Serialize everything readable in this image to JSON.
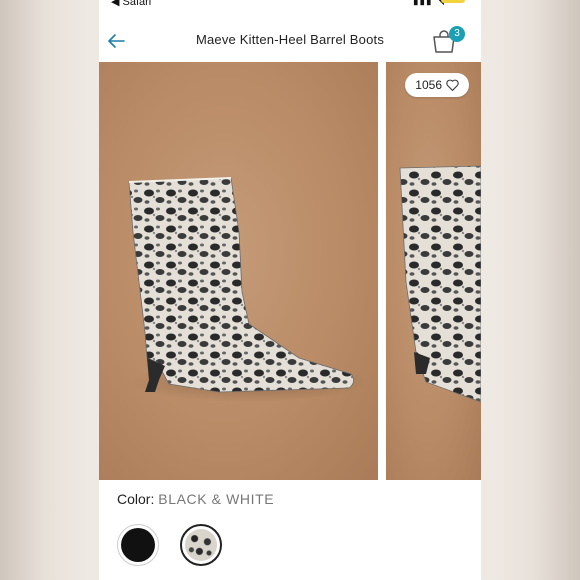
{
  "status_bar": {
    "back_app": "◀ Safari"
  },
  "header": {
    "title": "Maeve Kitten-Heel Barrel Boots",
    "bag_count": "3"
  },
  "gallery": {
    "favorite_count": "1056"
  },
  "product": {
    "color_label": "Color:",
    "color_value": "BLACK & WHITE",
    "swatches": [
      "black",
      "black-and-white snake print"
    ]
  },
  "colors": {
    "accent": "#1a9fb4",
    "backdrop": "#b98b66",
    "text": "#222222"
  }
}
